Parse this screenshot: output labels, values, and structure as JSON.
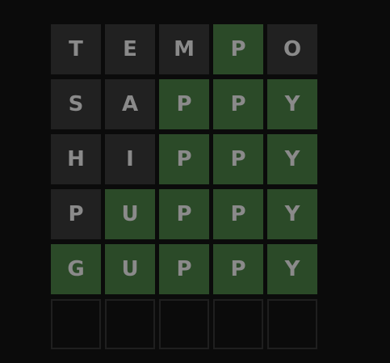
{
  "board": {
    "rows": [
      {
        "tiles": [
          {
            "letter": "T",
            "state": "absent"
          },
          {
            "letter": "E",
            "state": "absent"
          },
          {
            "letter": "M",
            "state": "absent"
          },
          {
            "letter": "P",
            "state": "correct"
          },
          {
            "letter": "O",
            "state": "absent"
          }
        ]
      },
      {
        "tiles": [
          {
            "letter": "S",
            "state": "absent"
          },
          {
            "letter": "A",
            "state": "absent"
          },
          {
            "letter": "P",
            "state": "correct"
          },
          {
            "letter": "P",
            "state": "correct"
          },
          {
            "letter": "Y",
            "state": "correct"
          }
        ]
      },
      {
        "tiles": [
          {
            "letter": "H",
            "state": "absent"
          },
          {
            "letter": "I",
            "state": "absent"
          },
          {
            "letter": "P",
            "state": "correct"
          },
          {
            "letter": "P",
            "state": "correct"
          },
          {
            "letter": "Y",
            "state": "correct"
          }
        ]
      },
      {
        "tiles": [
          {
            "letter": "P",
            "state": "absent"
          },
          {
            "letter": "U",
            "state": "correct"
          },
          {
            "letter": "P",
            "state": "correct"
          },
          {
            "letter": "P",
            "state": "correct"
          },
          {
            "letter": "Y",
            "state": "correct"
          }
        ]
      },
      {
        "tiles": [
          {
            "letter": "G",
            "state": "correct"
          },
          {
            "letter": "U",
            "state": "correct"
          },
          {
            "letter": "P",
            "state": "correct"
          },
          {
            "letter": "P",
            "state": "correct"
          },
          {
            "letter": "Y",
            "state": "correct"
          }
        ]
      },
      {
        "tiles": [
          {
            "letter": "",
            "state": "empty"
          },
          {
            "letter": "",
            "state": "empty"
          },
          {
            "letter": "",
            "state": "empty"
          },
          {
            "letter": "",
            "state": "empty"
          },
          {
            "letter": "",
            "state": "empty"
          }
        ]
      }
    ]
  },
  "colors": {
    "background": "#0b0b0b",
    "absent": "#212121",
    "correct": "#2b4a28",
    "empty_border": "#1f1f1f",
    "letter": "#8a8a8a"
  }
}
